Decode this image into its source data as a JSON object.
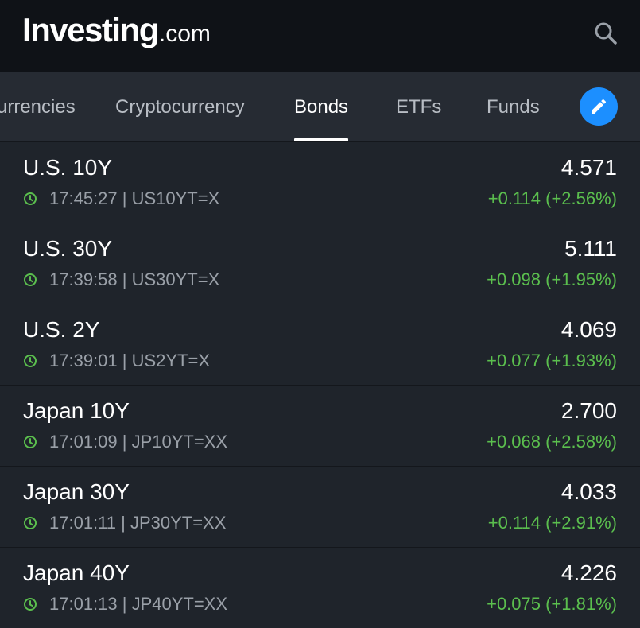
{
  "header": {
    "logo_main": "Investing",
    "logo_suffix": ".com",
    "search_icon": "search-icon"
  },
  "tabs": [
    {
      "label": "urrencies",
      "active": false
    },
    {
      "label": "Cryptocurrency",
      "active": false
    },
    {
      "label": "Bonds",
      "active": true
    },
    {
      "label": "ETFs",
      "active": false
    },
    {
      "label": "Funds",
      "active": false
    }
  ],
  "edit_icon": "pencil-icon",
  "colors": {
    "accent": "#1c8fff",
    "positive": "#5bbf4e",
    "background": "#1f242b",
    "header_bg": "#0f1217"
  },
  "rows": [
    {
      "name": "U.S. 10Y",
      "meta": "17:45:27 | US10YT=X",
      "price": "4.571",
      "change": "+0.114 (+2.56%)"
    },
    {
      "name": "U.S. 30Y",
      "meta": "17:39:58 | US30YT=X",
      "price": "5.111",
      "change": "+0.098 (+1.95%)"
    },
    {
      "name": "U.S. 2Y",
      "meta": "17:39:01 | US2YT=X",
      "price": "4.069",
      "change": "+0.077 (+1.93%)"
    },
    {
      "name": "Japan 10Y",
      "meta": "17:01:09 | JP10YT=XX",
      "price": "2.700",
      "change": "+0.068 (+2.58%)"
    },
    {
      "name": "Japan 30Y",
      "meta": "17:01:11 | JP30YT=XX",
      "price": "4.033",
      "change": "+0.114 (+2.91%)"
    },
    {
      "name": "Japan 40Y",
      "meta": "17:01:13 | JP40YT=XX",
      "price": "4.226",
      "change": "+0.075 (+1.81%)"
    }
  ]
}
